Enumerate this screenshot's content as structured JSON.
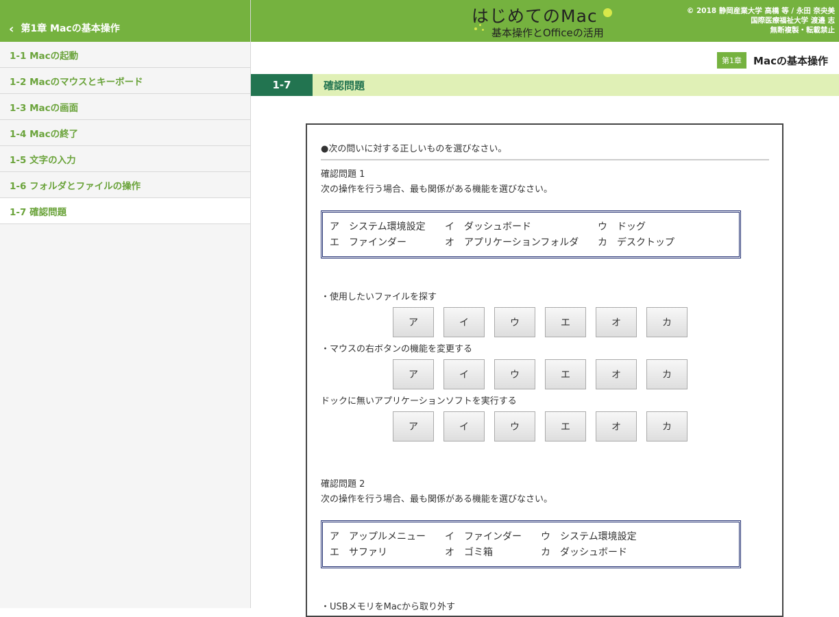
{
  "sidebar": {
    "back_label": "第1章 Macの基本操作",
    "items": [
      {
        "label": "1-1 Macの起動"
      },
      {
        "label": "1-2 Macのマウスとキーボード"
      },
      {
        "label": "1-3 Macの画面"
      },
      {
        "label": "1-4 Macの終了"
      },
      {
        "label": "1-5 文字の入力"
      },
      {
        "label": "1-6 フォルダとファイルの操作"
      },
      {
        "label": "1-7 確認問題",
        "active": true
      }
    ]
  },
  "header": {
    "logo_line1": "はじめてのMac",
    "logo_line2": "基本操作とOfficeの活用",
    "copyright": [
      "© 2018 静岡産業大学 高橋 等 / 永田 奈央美",
      "国際医療福祉大学 渡邉 志",
      "無断複製・転載禁止"
    ],
    "accent_color": "#75b23f"
  },
  "chapter": {
    "badge": "第1章",
    "title": "Macの基本操作"
  },
  "section": {
    "number": "1-7",
    "title": "確認問題",
    "number_bg": "#227450",
    "bar_bg": "#e0f0b6"
  },
  "content": {
    "instruction": "●次の問いに対する正しいものを選びなさい。",
    "q1": {
      "title": "確認問題 1",
      "prompt": "次の操作を行う場合、最も関係がある機能を選びなさい。",
      "options": [
        {
          "key": "ア",
          "text": "システム環境設定"
        },
        {
          "key": "イ",
          "text": "ダッシュボード"
        },
        {
          "key": "ウ",
          "text": "ドッグ"
        },
        {
          "key": "エ",
          "text": "ファインダー"
        },
        {
          "key": "オ",
          "text": "アプリケーションフォルダ"
        },
        {
          "key": "カ",
          "text": "デスクトップ"
        }
      ],
      "tasks": [
        "・使用したいファイルを探す",
        "・マウスの右ボタンの機能を変更する",
        "ドックに無いアプリケーションソフトを実行する"
      ]
    },
    "q2": {
      "title": "確認問題 2",
      "prompt": "次の操作を行う場合、最も関係がある機能を選びなさい。",
      "options": [
        {
          "key": "ア",
          "text": "アップルメニュー"
        },
        {
          "key": "イ",
          "text": "ファインダー"
        },
        {
          "key": "ウ",
          "text": "システム環境設定"
        },
        {
          "key": "エ",
          "text": "サファリ"
        },
        {
          "key": "オ",
          "text": "ゴミ箱"
        },
        {
          "key": "カ",
          "text": "ダッシュボード"
        }
      ],
      "tasks": [
        "・USBメモリをMacから取り外す"
      ]
    },
    "answer_labels": [
      "ア",
      "イ",
      "ウ",
      "エ",
      "オ",
      "カ"
    ]
  }
}
